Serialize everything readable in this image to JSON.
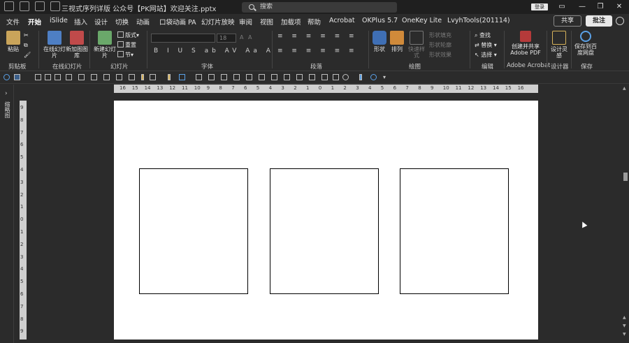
{
  "window": {
    "title": "三视式序列详版 公众号【PK网站】欢迎关注.pptx",
    "search_placeholder": "搜索",
    "signin_label": "登录",
    "minimize": "—",
    "restore": "❐",
    "close": "✕"
  },
  "tabs": [
    {
      "label": "文件"
    },
    {
      "label": "开始"
    },
    {
      "label": "iSlide"
    },
    {
      "label": "插入"
    },
    {
      "label": "设计"
    },
    {
      "label": "切换"
    },
    {
      "label": "动画"
    },
    {
      "label": "口袋动画 PA"
    },
    {
      "label": "幻灯片放映"
    },
    {
      "label": "审阅"
    },
    {
      "label": "视图"
    },
    {
      "label": "加载项"
    },
    {
      "label": "帮助"
    },
    {
      "label": "Acrobat"
    },
    {
      "label": "OKPlus 5.7"
    },
    {
      "label": "OneKey Lite"
    },
    {
      "label": "LvyhTools(201114)"
    }
  ],
  "header_actions": {
    "share": "共享",
    "comment": "批注"
  },
  "ribbon": {
    "clipboard": {
      "paste": "粘贴",
      "label": "剪贴板"
    },
    "online_slides": {
      "btn1": "在线幻灯片",
      "btn2": "新加图图库",
      "label": "在线幻灯片"
    },
    "slides": {
      "new_slide": "新建幻灯片",
      "layout": "版式",
      "reset": "重置",
      "section": "节",
      "label": "幻灯片"
    },
    "font": {
      "size": "18",
      "label": "字体",
      "row": "B I U S ab AV Aa A"
    },
    "paragraph": {
      "label": "段落",
      "row1": "≡ ≡ ≡ ≡ ≡ ≡",
      "row2": "≡ ≡ ≡ ≡ ≡ ≡"
    },
    "drawing": {
      "shape": "形状",
      "arrange": "排列",
      "quick_styles": "快速样式",
      "fill": "形状填充",
      "outline": "形状轮廓",
      "effects": "形状效果",
      "label": "绘图"
    },
    "editing": {
      "find": "查找",
      "replace": "替换",
      "select": "选择",
      "label": "编辑"
    },
    "acrobat": {
      "create": "创建并共享 Adobe PDF",
      "label": "Adobe Acrobat"
    },
    "designer": {
      "ideas": "设计灵感",
      "label": "设计器"
    },
    "save": {
      "save_to": "保存到百度网盘",
      "label": "保存"
    }
  },
  "left_pane": {
    "expand": "›",
    "label": "缩略图"
  },
  "ruler_h": [
    "16",
    "15",
    "14",
    "13",
    "12",
    "11",
    "10",
    "9",
    "8",
    "7",
    "6",
    "5",
    "4",
    "3",
    "2",
    "1",
    "0",
    "1",
    "2",
    "3",
    "4",
    "5",
    "6",
    "7",
    "8",
    "9",
    "10",
    "11",
    "12",
    "13",
    "14",
    "15",
    "16"
  ],
  "ruler_v": [
    "9",
    "8",
    "7",
    "6",
    "5",
    "4",
    "3",
    "2",
    "1",
    "0",
    "1",
    "2",
    "3",
    "4",
    "5",
    "6",
    "7",
    "8",
    "9"
  ]
}
